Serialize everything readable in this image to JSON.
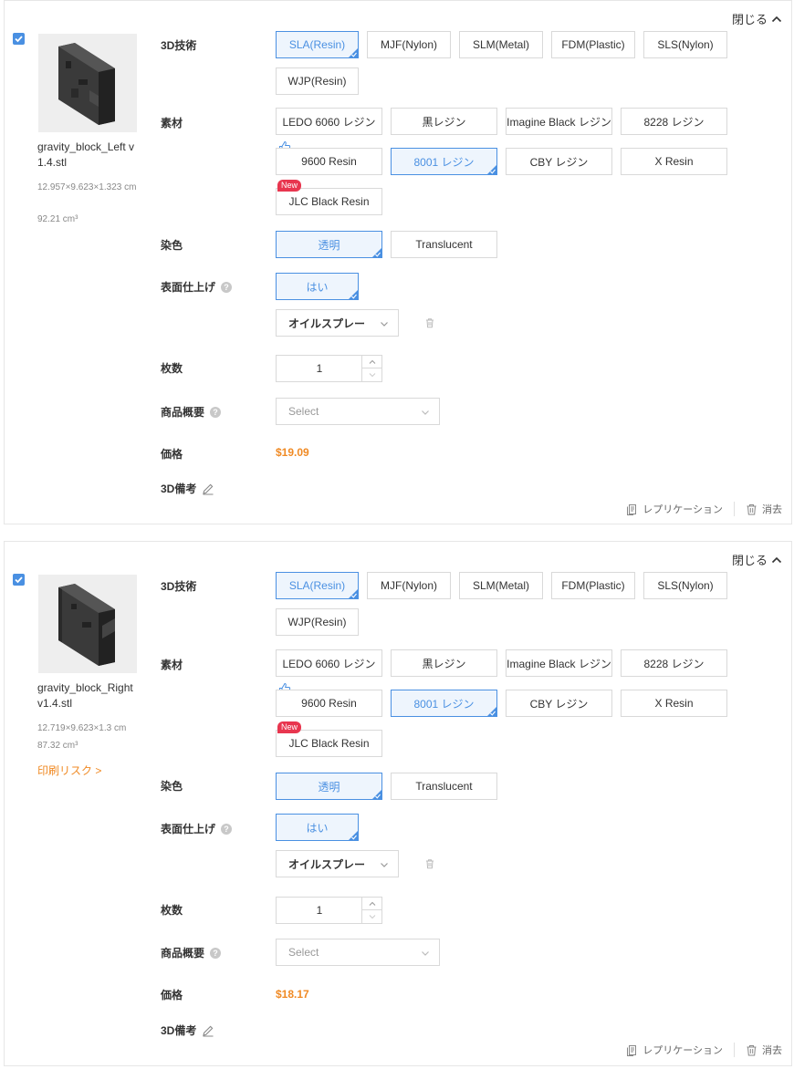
{
  "labels": {
    "collapse": "閉じる",
    "technology": "3D技術",
    "material": "素材",
    "color": "染色",
    "finish": "表面仕上げ",
    "quantity": "枚数",
    "description": "商品概要",
    "price": "価格",
    "note": "3D備考",
    "replicate": "レプリケーション",
    "delete": "消去",
    "new_badge": "New",
    "help": "?"
  },
  "technologies": [
    "SLA(Resin)",
    "MJF(Nylon)",
    "SLM(Metal)",
    "FDM(Plastic)",
    "SLS(Nylon)",
    "WJP(Resin)"
  ],
  "materials": [
    "LEDO 6060 レジン",
    "黒レジン",
    "Imagine Black レジン",
    "8228 レジン",
    "9600 Resin",
    "8001 レジン",
    "CBY レジン",
    "X Resin",
    "JLC Black Resin"
  ],
  "colors": [
    "透明",
    "Translucent"
  ],
  "finish_options": [
    "はい"
  ],
  "finish_method": "オイルスプレー",
  "description_placeholder": "Select",
  "items": [
    {
      "checked": true,
      "filename": "gravity_block_Left v1.4.stl",
      "dimensions": "12.957×9.623×1.323 cm",
      "volume": "92.21 cm³",
      "risk": "",
      "selected_technology": "SLA(Resin)",
      "selected_material": "8001 レジン",
      "selected_color": "透明",
      "selected_finish": "はい",
      "quantity": "1",
      "price": "$19.09"
    },
    {
      "checked": true,
      "filename": "gravity_block_Right v1.4.stl",
      "dimensions": "12.719×9.623×1.3 cm",
      "volume": "87.32 cm³",
      "risk": "印刷リスク >",
      "selected_technology": "SLA(Resin)",
      "selected_material": "8001 レジン",
      "selected_color": "透明",
      "selected_finish": "はい",
      "quantity": "1",
      "price": "$18.17"
    }
  ],
  "colors_hex": {
    "accent": "#4a90e2",
    "price": "#f08a24",
    "badge": "#e8364f"
  }
}
